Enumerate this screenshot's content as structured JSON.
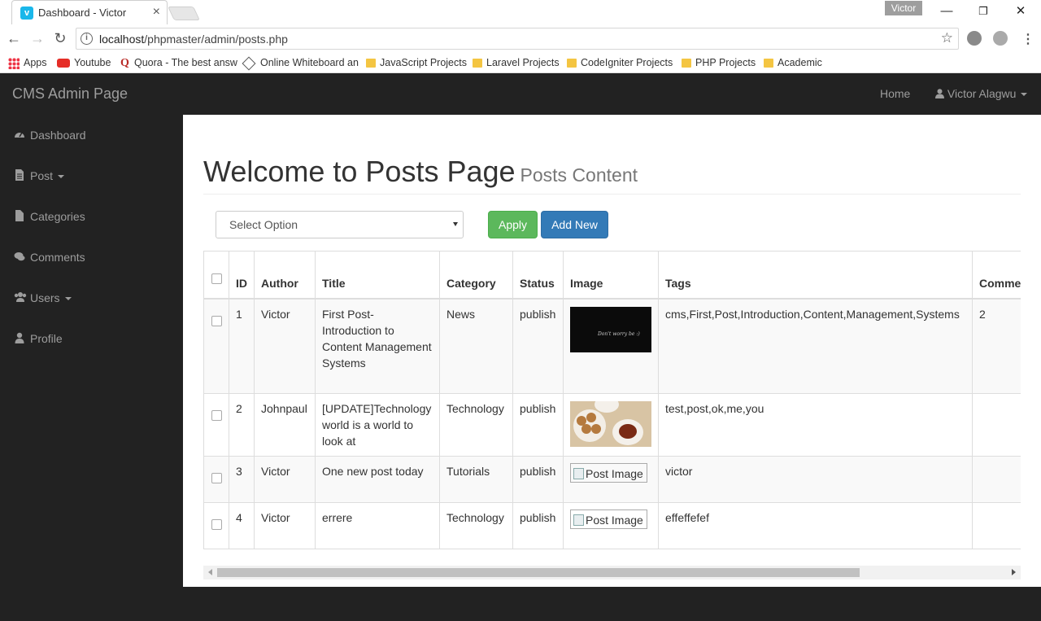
{
  "browser": {
    "tab_title": "Dashboard - Victor",
    "tab_close": "×",
    "profile_name": "Victor",
    "url_host": "localhost",
    "url_path": "/phpmaster/admin/posts.php",
    "bookmarks": [
      {
        "label": "Apps",
        "icon": "apps-grid-icon"
      },
      {
        "label": "Youtube",
        "icon": "youtube-icon"
      },
      {
        "label": "Quora - The best answ",
        "icon": "quora-icon"
      },
      {
        "label": "Online Whiteboard an",
        "icon": "whiteboard-icon"
      },
      {
        "label": "JavaScript Projects",
        "icon": "folder-icon"
      },
      {
        "label": "Laravel Projects",
        "icon": "folder-icon"
      },
      {
        "label": "CodeIgniter Projects",
        "icon": "folder-icon"
      },
      {
        "label": "PHP Projects",
        "icon": "folder-icon"
      },
      {
        "label": "Academic",
        "icon": "folder-icon"
      }
    ]
  },
  "navbar": {
    "brand": "CMS Admin Page",
    "home": "Home",
    "user": "Victor Alagwu"
  },
  "sidebar": {
    "items": [
      {
        "label": "Dashboard",
        "icon": "dashboard-icon",
        "dropdown": false
      },
      {
        "label": "Post",
        "icon": "file-text-icon",
        "dropdown": true
      },
      {
        "label": "Categories",
        "icon": "file-icon",
        "dropdown": false
      },
      {
        "label": "Comments",
        "icon": "comments-icon",
        "dropdown": false
      },
      {
        "label": "Users",
        "icon": "users-icon",
        "dropdown": true
      },
      {
        "label": "Profile",
        "icon": "user-icon",
        "dropdown": false
      }
    ]
  },
  "page": {
    "title": "Welcome to Posts Page",
    "subtitle": "Posts Content",
    "bulk_select": "Select Option",
    "apply_label": "Apply",
    "add_new_label": "Add New"
  },
  "table": {
    "headers": [
      "",
      "ID",
      "Author",
      "Title",
      "Category",
      "Status",
      "Image",
      "Tags",
      "Comme"
    ],
    "rows": [
      {
        "id": "1",
        "author": "Victor",
        "title": "First Post- Introduction to Content Management Systems",
        "category": "News",
        "status": "publish",
        "image": "dark-quote-image",
        "image_text": "Don't worry be :)",
        "tags": "cms,First,Post,Introduction,Content,Management,Systems",
        "comments": "2"
      },
      {
        "id": "2",
        "author": "Johnpaul",
        "title": "[UPDATE]Technology world is a world to look at",
        "category": "Technology",
        "status": "publish",
        "image": "tea-cookies-image",
        "tags": "test,post,ok,me,you",
        "comments": ""
      },
      {
        "id": "3",
        "author": "Victor",
        "title": "One new post today",
        "category": "Tutorials",
        "status": "publish",
        "image": "broken",
        "image_alt": "Post Image",
        "tags": "victor",
        "comments": ""
      },
      {
        "id": "4",
        "author": "Victor",
        "title": "errere",
        "category": "Technology",
        "status": "publish",
        "image": "broken",
        "image_alt": "Post Image",
        "tags": "effeffefef",
        "comments": ""
      }
    ]
  },
  "colors": {
    "navbar_bg": "#222222",
    "apply_btn": "#5cb85c",
    "add_new_btn": "#337ab7"
  }
}
